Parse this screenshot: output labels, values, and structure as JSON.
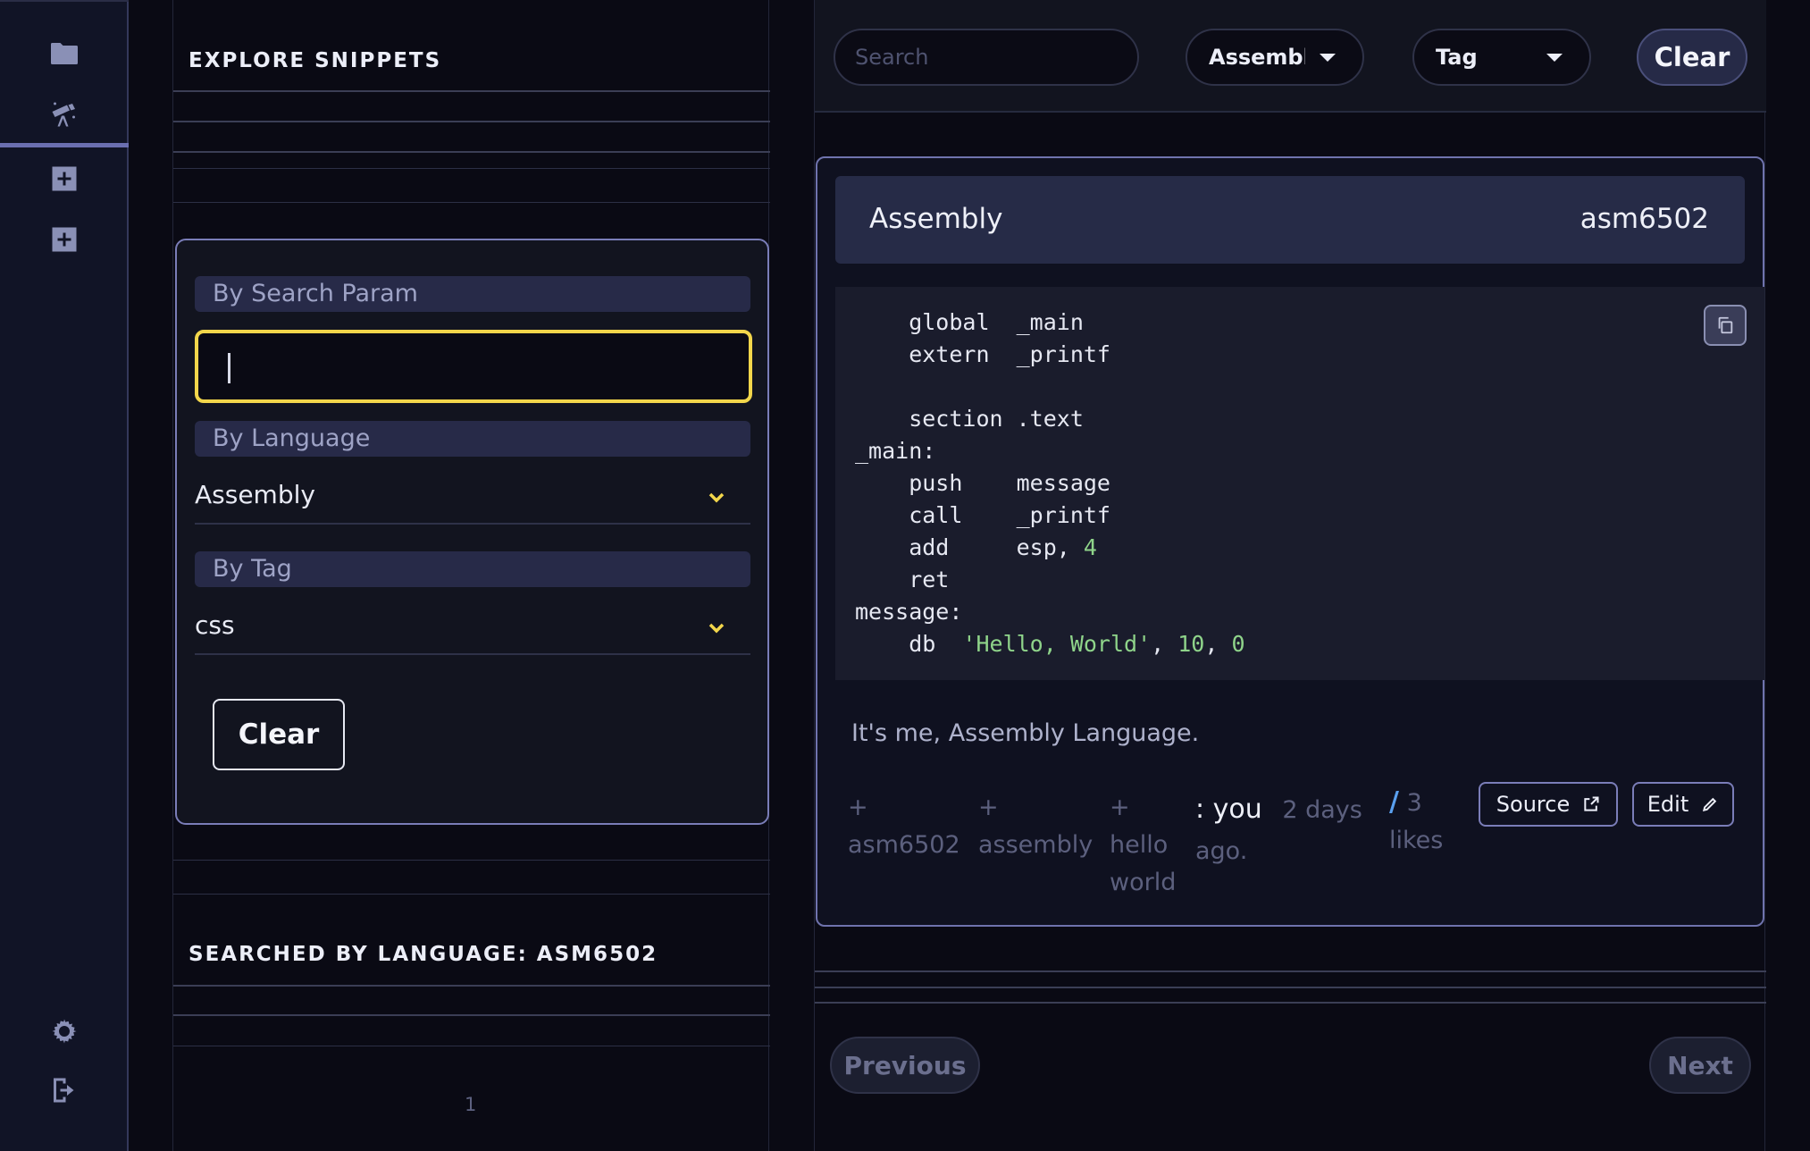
{
  "rail": {
    "icons": [
      "folder-icon",
      "telescope-icon",
      "add-square-icon",
      "add-square-icon",
      "settings-gear-icon",
      "logout-icon"
    ]
  },
  "explorer": {
    "title": "EXPLORE SNIPPETS",
    "filters": {
      "search_label": "By Search Param",
      "search_value": "",
      "language_label": "By Language",
      "language_value": "Assembly",
      "tag_label": "By Tag",
      "tag_value": "css",
      "clear_label": "Clear"
    },
    "searched_title": "SEARCHED BY LANGUAGE: ASM6502",
    "page_number": "1"
  },
  "topbar": {
    "search_placeholder": "Search",
    "language_select": "Assembly",
    "tag_select": "Tag",
    "clear_label": "Clear"
  },
  "snippet": {
    "language": "Assembly",
    "tag": "asm6502",
    "description": "It's me, Assembly Language.",
    "tags": [
      {
        "label": "asm6502"
      },
      {
        "label": "assembly"
      },
      {
        "label": "hello world"
      }
    ],
    "author_prefix": ": you",
    "time": "2 days ago.",
    "likes_prefix": "/",
    "likes": "3 likes",
    "source_label": "Source",
    "edit_label": "Edit"
  },
  "pagination": {
    "previous_label": "Previous",
    "next_label": "Next"
  }
}
